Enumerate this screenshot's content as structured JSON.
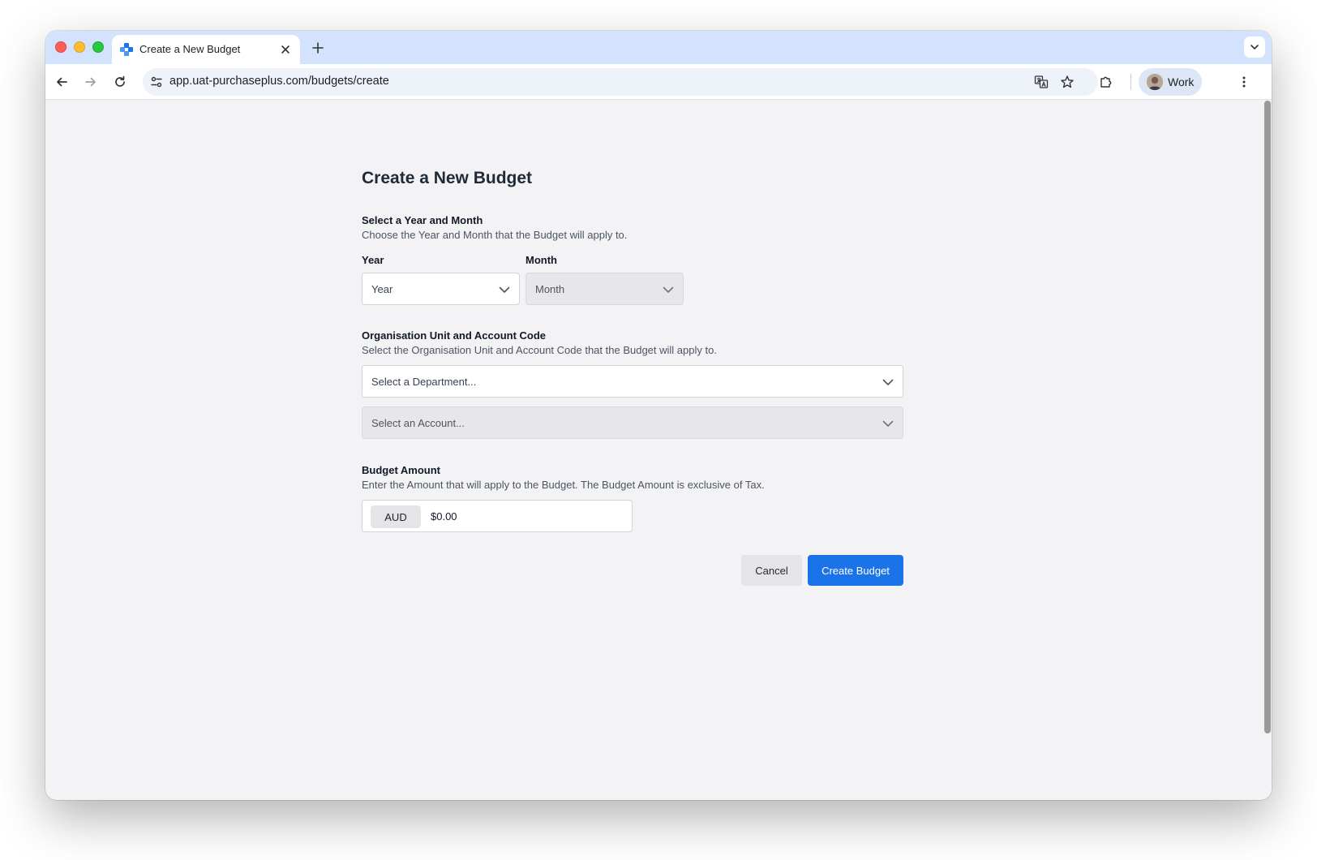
{
  "browser": {
    "tab": {
      "title": "Create a New Budget",
      "close_glyph": "✕"
    },
    "new_tab_glyph": "+",
    "url": "app.uat-purchaseplus.com/budgets/create",
    "profile": {
      "label": "Work"
    },
    "icons": {
      "back": "back-arrow-icon",
      "forward": "forward-arrow-icon",
      "reload": "reload-icon",
      "site_info": "tune-icon",
      "translate": "translate-icon",
      "bookmark": "star-icon",
      "extensions": "puzzle-icon",
      "menu": "kebab-menu-icon",
      "tab_search": "chevron-down-icon"
    }
  },
  "page": {
    "title": "Create a New Budget",
    "period": {
      "title": "Select a Year and Month",
      "description": "Choose the Year and Month that the Budget will apply to.",
      "year_label": "Year",
      "year_value": "Year",
      "month_label": "Month",
      "month_value": "Month"
    },
    "org": {
      "title": "Organisation Unit and Account Code",
      "description": "Select the Organisation Unit and Account Code that the Budget will apply to.",
      "department_placeholder": "Select a Department...",
      "account_placeholder": "Select an Account..."
    },
    "amount": {
      "title": "Budget Amount",
      "description": "Enter the Amount that will apply to the Budget. The Budget Amount is exclusive of Tax.",
      "currency": "AUD",
      "value": "$0.00"
    },
    "actions": {
      "cancel": "Cancel",
      "create": "Create Budget"
    }
  },
  "colors": {
    "tabstrip": "#d3e3fd",
    "page_background": "#f3f3f6",
    "primary_button": "#1a73e8",
    "secondary_button": "#e4e4e9"
  }
}
